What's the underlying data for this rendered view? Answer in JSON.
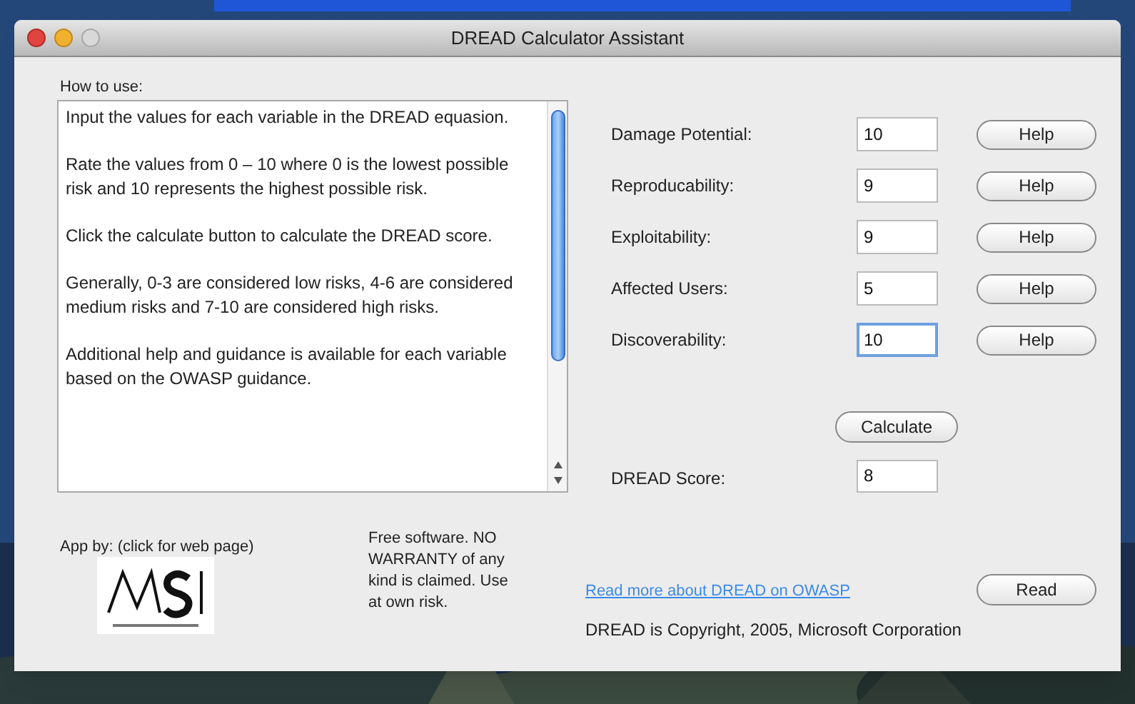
{
  "window": {
    "title": "DREAD Calculator Assistant"
  },
  "instructions": {
    "label": "How to use:",
    "paragraphs": [
      "Input the values for each variable in the DREAD equasion.",
      "Rate the values from 0 – 10 where 0 is the lowest possible risk and 10 represents the highest possible risk.",
      "Click the calculate button to calculate the DREAD score.",
      "Generally, 0-3 are considered low risks, 4-6 are considered medium risks and 7-10 are considered high risks.",
      "Additional help and guidance is available for each variable based on the OWASP guidance."
    ]
  },
  "variables": [
    {
      "label": "Damage Potential:",
      "value": "10",
      "focused": false,
      "help": "Help"
    },
    {
      "label": "Reproducability:",
      "value": "9",
      "focused": false,
      "help": "Help"
    },
    {
      "label": "Exploitability:",
      "value": "9",
      "focused": false,
      "help": "Help"
    },
    {
      "label": "Affected Users:",
      "value": "5",
      "focused": false,
      "help": "Help"
    },
    {
      "label": "Discoverability:",
      "value": "10",
      "focused": true,
      "help": "Help"
    }
  ],
  "calculate_button": "Calculate",
  "score": {
    "label": "DREAD Score:",
    "value": "8"
  },
  "credits": {
    "label": "App by: (click for web page)",
    "disclaimer": "Free software. NO WARRANTY of any kind is claimed. Use at own risk."
  },
  "owasp_link": "Read more about DREAD on OWASP",
  "read_button": "Read",
  "copyright": "DREAD is Copyright, 2005, Microsoft Corporation"
}
